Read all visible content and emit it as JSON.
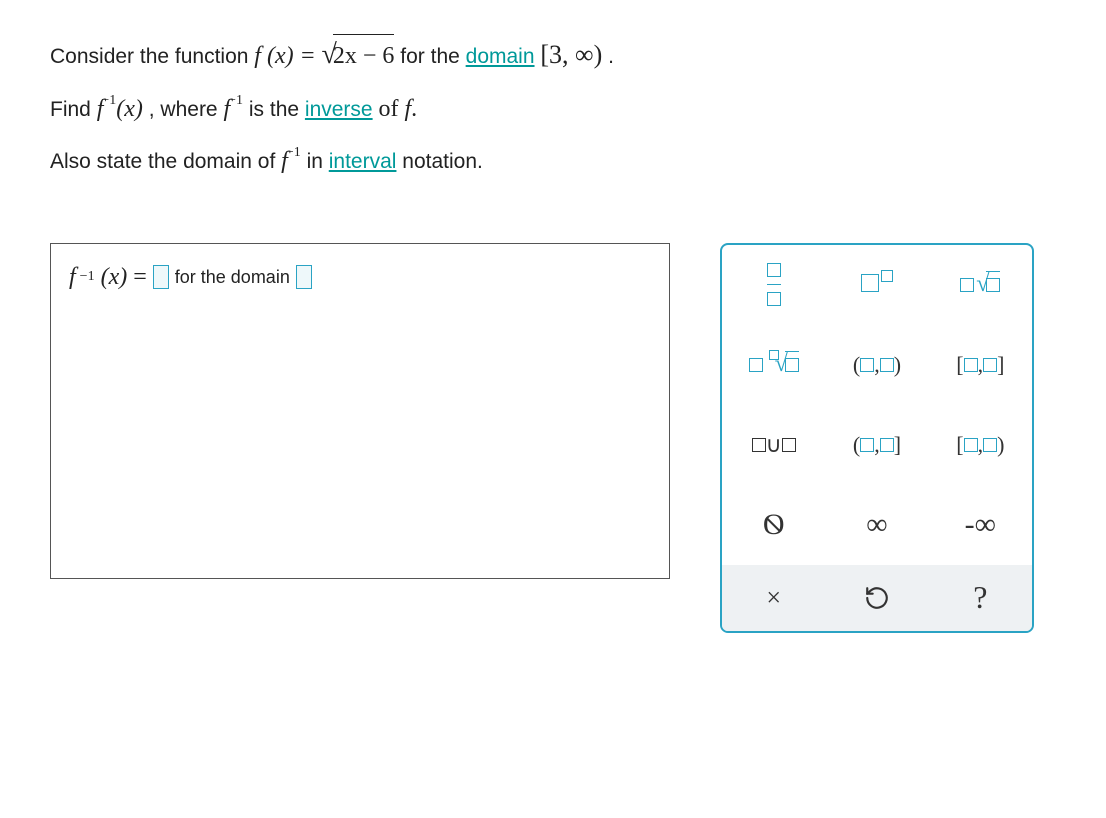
{
  "problem": {
    "line1_pre": "Consider the function ",
    "f_of_x": "f (x)",
    "equals": "=",
    "sqrt_arg": "2x − 6",
    "line1_mid": " for the ",
    "domain_link": "domain",
    "domain_interval": "[3, ∞)",
    "period": ".",
    "line2_pre": "Find ",
    "f_inv_x": "f",
    "neg1": "−1",
    "x_paren": "(x)",
    "where_text": ", where ",
    "is_the": " is the ",
    "inverse_link": "inverse",
    "of_f": " of f.",
    "line3_pre": "Also state the domain of ",
    "in_text": " in ",
    "interval_link": "interval",
    "notation_text": " notation."
  },
  "answer_area": {
    "lhs": "f",
    "neg1": "−1",
    "x_paren": " (x) ",
    "equals": "=",
    "for_domain_text": "for  the  domain"
  },
  "keypad": {
    "keys": {
      "fraction": "fraction",
      "exponent": "exponent",
      "sqrt": "square-root",
      "nth_root": "nth-root",
      "open_open": "(□,□)",
      "closed_closed": "[□,□]",
      "union": "□∪□",
      "open_closed": "(□,□]",
      "closed_open": "[□,□)",
      "empty_set": "∅",
      "infinity": "∞",
      "neg_infinity": "-∞",
      "clear": "×",
      "undo": "↶",
      "help": "?"
    }
  }
}
